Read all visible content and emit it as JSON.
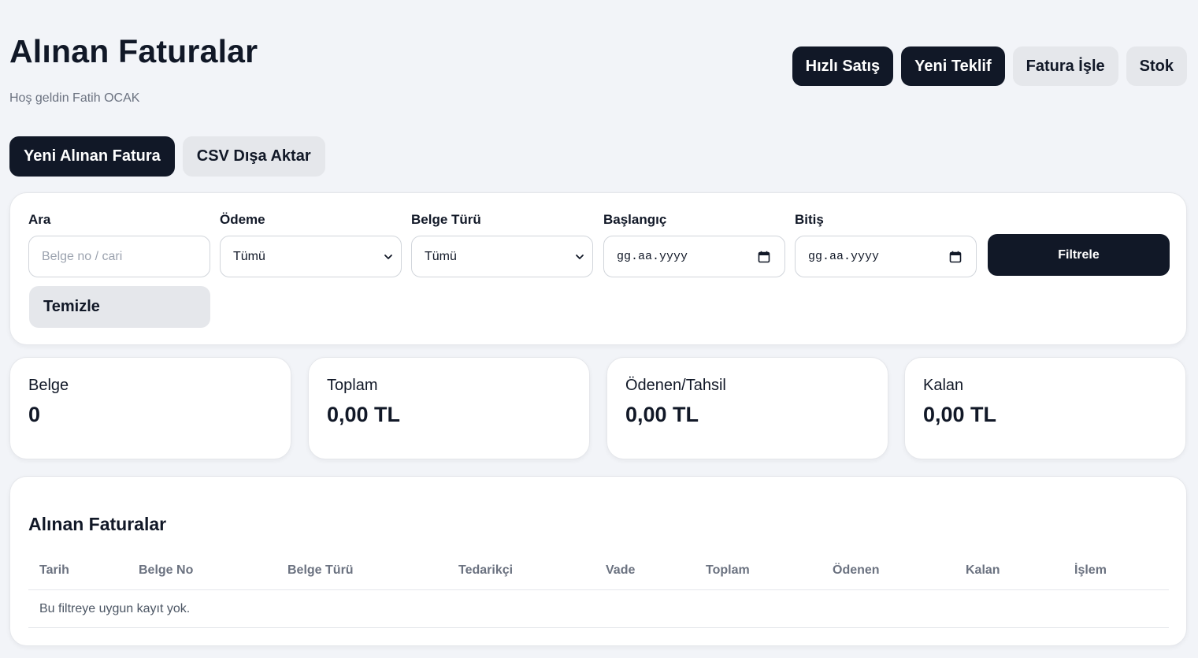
{
  "header": {
    "title": "Alınan Faturalar",
    "greeting": "Hoş geldin Fatih OCAK"
  },
  "top_actions": {
    "quick_sale": "Hızlı Satış",
    "new_offer": "Yeni Teklif",
    "process_invoice": "Fatura İşle",
    "stock": "Stok"
  },
  "secondary_actions": {
    "new_invoice": "Yeni Alınan Fatura",
    "csv_export": "CSV Dışa Aktar"
  },
  "filters": {
    "search": {
      "label": "Ara",
      "placeholder": "Belge no / cari",
      "value": ""
    },
    "payment": {
      "label": "Ödeme",
      "selected": "Tümü"
    },
    "doc_type": {
      "label": "Belge Türü",
      "selected": "Tümü"
    },
    "start": {
      "label": "Başlangıç",
      "value": "gg.aa.yyyy"
    },
    "end": {
      "label": "Bitiş",
      "value": "gg.aa.yyyy"
    },
    "filter_button": "Filtrele",
    "clear_button": "Temizle"
  },
  "stats": [
    {
      "label": "Belge",
      "value": "0"
    },
    {
      "label": "Toplam",
      "value": "0,00 TL"
    },
    {
      "label": "Ödenen/Tahsil",
      "value": "0,00 TL"
    },
    {
      "label": "Kalan",
      "value": "0,00 TL"
    }
  ],
  "table": {
    "title": "Alınan Faturalar",
    "columns": [
      "Tarih",
      "Belge No",
      "Belge Türü",
      "Tedarikçi",
      "Vade",
      "Toplam",
      "Ödenen",
      "Kalan",
      "İşlem"
    ],
    "empty_message": "Bu filtreye uygun kayıt yok."
  },
  "colors": {
    "background": "#f2f4f8",
    "primary_dark": "#111827",
    "secondary_light": "#e5e7eb",
    "muted_text": "#6b7280"
  },
  "icons": {
    "select": "chevron-down-icon",
    "date": "calendar-icon"
  }
}
